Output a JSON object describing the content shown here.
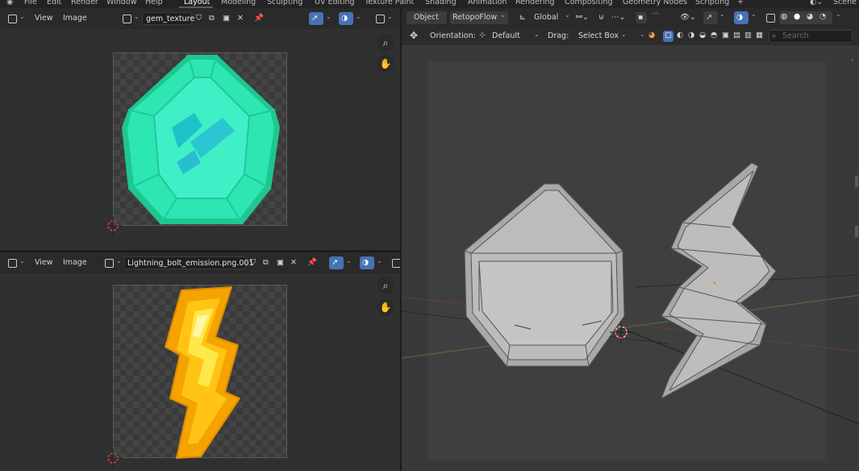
{
  "menu": {
    "items": [
      "File",
      "Edit",
      "Render",
      "Window",
      "Help"
    ],
    "workspaces": [
      "Layout",
      "Modeling",
      "Sculpting",
      "UV Editing",
      "Texture Paint",
      "Shading",
      "Animation",
      "Rendering",
      "Compositing",
      "Geometry Nodes",
      "Scripting"
    ],
    "active_workspace": "Layout",
    "scene_label": "Scene"
  },
  "image_editor_top": {
    "view_label": "View",
    "image_label": "Image",
    "image_name": "gem_texture"
  },
  "image_editor_bottom": {
    "view_label": "View",
    "image_label": "Image",
    "image_name": "Lightning_bolt_emission.png.001"
  },
  "viewport": {
    "mode_label": "Object",
    "addon_label": "RetopoFlow",
    "transform_orientation": "Global",
    "orientation_label": "Orientation:",
    "orientation_value": "Default",
    "drag_label": "Drag:",
    "drag_value": "Select Box",
    "search_placeholder": "Search"
  },
  "colors": {
    "accent": "#4772b3",
    "gem_fill": "#2de6b1",
    "bolt_fill": "#ffd020",
    "bolt_outline": "#f5a300"
  }
}
